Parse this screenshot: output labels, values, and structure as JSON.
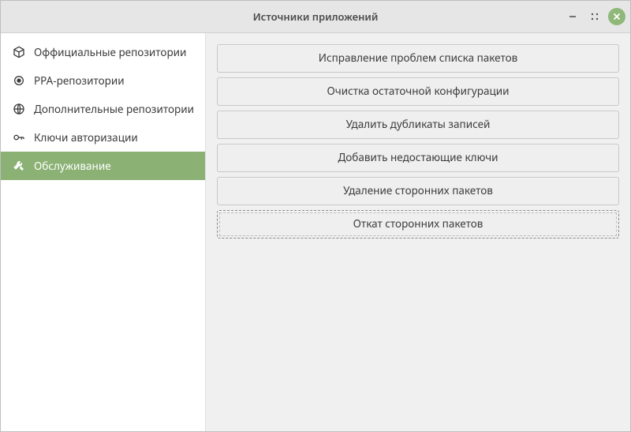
{
  "window": {
    "title": "Источники приложений"
  },
  "sidebar": {
    "items": [
      {
        "id": "official-repos",
        "label": "Оффициальные репозитории"
      },
      {
        "id": "ppa-repos",
        "label": "PPA-репозитории"
      },
      {
        "id": "additional-repos",
        "label": "Дополнительные репозитории"
      },
      {
        "id": "auth-keys",
        "label": "Ключи авторизации"
      },
      {
        "id": "maintenance",
        "label": "Обслуживание"
      }
    ],
    "active_index": 4
  },
  "maintenance": {
    "actions": [
      {
        "id": "fix-package-list",
        "label": "Исправление проблем списка пакетов"
      },
      {
        "id": "purge-residual",
        "label": "Очистка остаточной конфигурации"
      },
      {
        "id": "remove-duplicates",
        "label": "Удалить дубликаты записей"
      },
      {
        "id": "add-missing-keys",
        "label": "Добавить недостающие ключи"
      },
      {
        "id": "remove-foreign",
        "label": "Удаление сторонних пакетов"
      },
      {
        "id": "downgrade-foreign",
        "label": "Откат сторонних пакетов"
      }
    ],
    "focused_index": 5
  },
  "colors": {
    "accent": "#8bb174",
    "titlebar": "#e6e6e6",
    "content_bg": "#f0f0f0"
  }
}
